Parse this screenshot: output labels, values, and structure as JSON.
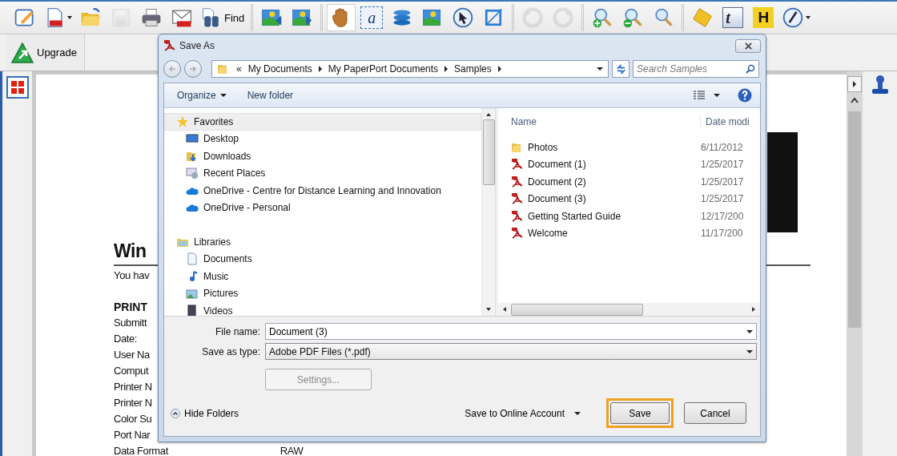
{
  "toolbar": {
    "groups": [
      {
        "items": [
          {
            "disabled": false
          },
          {
            "disabled": false
          },
          {
            "disabled": false
          },
          {
            "disabled": true
          },
          {
            "disabled": false
          },
          {
            "disabled": false
          },
          {
            "disabled": false,
            "label": "Find"
          }
        ]
      },
      {
        "items": [
          {
            "disabled": false
          },
          {
            "disabled": false
          }
        ]
      },
      {
        "items": [
          {
            "selected": true
          },
          {
            "selected": false,
            "glyph": "a"
          },
          {
            "selected": false
          },
          {
            "selected": false
          },
          {
            "selected": false
          },
          {
            "selected": false
          }
        ]
      },
      {
        "items": [
          {
            "disabled": true
          },
          {
            "disabled": true
          }
        ]
      },
      {
        "items": [
          {
            "disabled": false
          },
          {
            "disabled": false
          },
          {
            "disabled": false
          }
        ]
      },
      {
        "items": [
          {
            "disabled": false
          },
          {
            "disabled": false,
            "glyph": "t"
          },
          {
            "disabled": false,
            "glyph": "H"
          },
          {
            "disabled": false
          }
        ]
      }
    ]
  },
  "upgrade_button": {
    "label": "Upgrade"
  },
  "document": {
    "lines": [
      {
        "kind": "heading",
        "text": "Win"
      },
      {
        "kind": "body",
        "text": "You hav"
      },
      {
        "kind": "section",
        "text": "PRINT"
      },
      {
        "kind": "field",
        "text": "Submitt"
      },
      {
        "kind": "field",
        "text": "Date:"
      },
      {
        "kind": "field",
        "text": "User Na"
      },
      {
        "kind": "field",
        "text": "Comput"
      },
      {
        "kind": "field",
        "text": "Printer N"
      },
      {
        "kind": "field",
        "text": "Printer N"
      },
      {
        "kind": "field",
        "text": "Color Su"
      },
      {
        "kind": "field",
        "text": "Port Nar"
      },
      {
        "kind": "field",
        "text": "Data Format",
        "value": "RAW"
      }
    ]
  },
  "dialog": {
    "title": "Save As",
    "breadcrumb": {
      "overflow": "«",
      "segments": [
        "My Documents",
        "My PaperPort Documents",
        "Samples"
      ]
    },
    "search": {
      "placeholder": "Search Samples"
    },
    "commands": {
      "organize": "Organize",
      "new_folder": "New folder"
    },
    "navigation": [
      {
        "label": "Favorites",
        "selected": true,
        "children": [
          {
            "label": "Desktop",
            "selected": false
          },
          {
            "label": "Downloads",
            "selected": false
          },
          {
            "label": "Recent Places",
            "selected": false
          },
          {
            "label": "OneDrive - Centre for Distance Learning and Innovation",
            "selected": false
          },
          {
            "label": "OneDrive - Personal",
            "selected": false
          }
        ]
      },
      {
        "label": "Libraries",
        "selected": false,
        "children": [
          {
            "label": "Documents",
            "selected": false
          },
          {
            "label": "Music",
            "selected": false
          },
          {
            "label": "Pictures",
            "selected": false
          },
          {
            "label": "Videos",
            "selected": false
          }
        ]
      }
    ],
    "files": {
      "columns": [
        "Name",
        "Date modi"
      ],
      "rows": [
        {
          "kind": "folder",
          "name": "Photos",
          "date": "6/11/2012"
        },
        {
          "kind": "pdf",
          "name": "Document (1)",
          "date": "1/25/2017"
        },
        {
          "kind": "pdf",
          "name": "Document (2)",
          "date": "1/25/2017"
        },
        {
          "kind": "pdf",
          "name": "Document (3)",
          "date": "1/25/2017"
        },
        {
          "kind": "pdf",
          "name": "Getting Started Guide",
          "date": "12/17/200"
        },
        {
          "kind": "pdf",
          "name": "Welcome",
          "date": "11/17/200"
        }
      ]
    },
    "file_name": {
      "label": "File name:",
      "value": "Document (3)"
    },
    "save_as_type": {
      "label": "Save as type:",
      "value": "Adobe PDF Files (*.pdf)"
    },
    "settings_button": {
      "label": "Settings...",
      "disabled": true
    },
    "hide_folders": "Hide Folders",
    "online_account": "Save to Online Account",
    "buttons": [
      {
        "label": "Save",
        "highlighted": true
      },
      {
        "label": "Cancel",
        "highlighted": false
      }
    ]
  }
}
